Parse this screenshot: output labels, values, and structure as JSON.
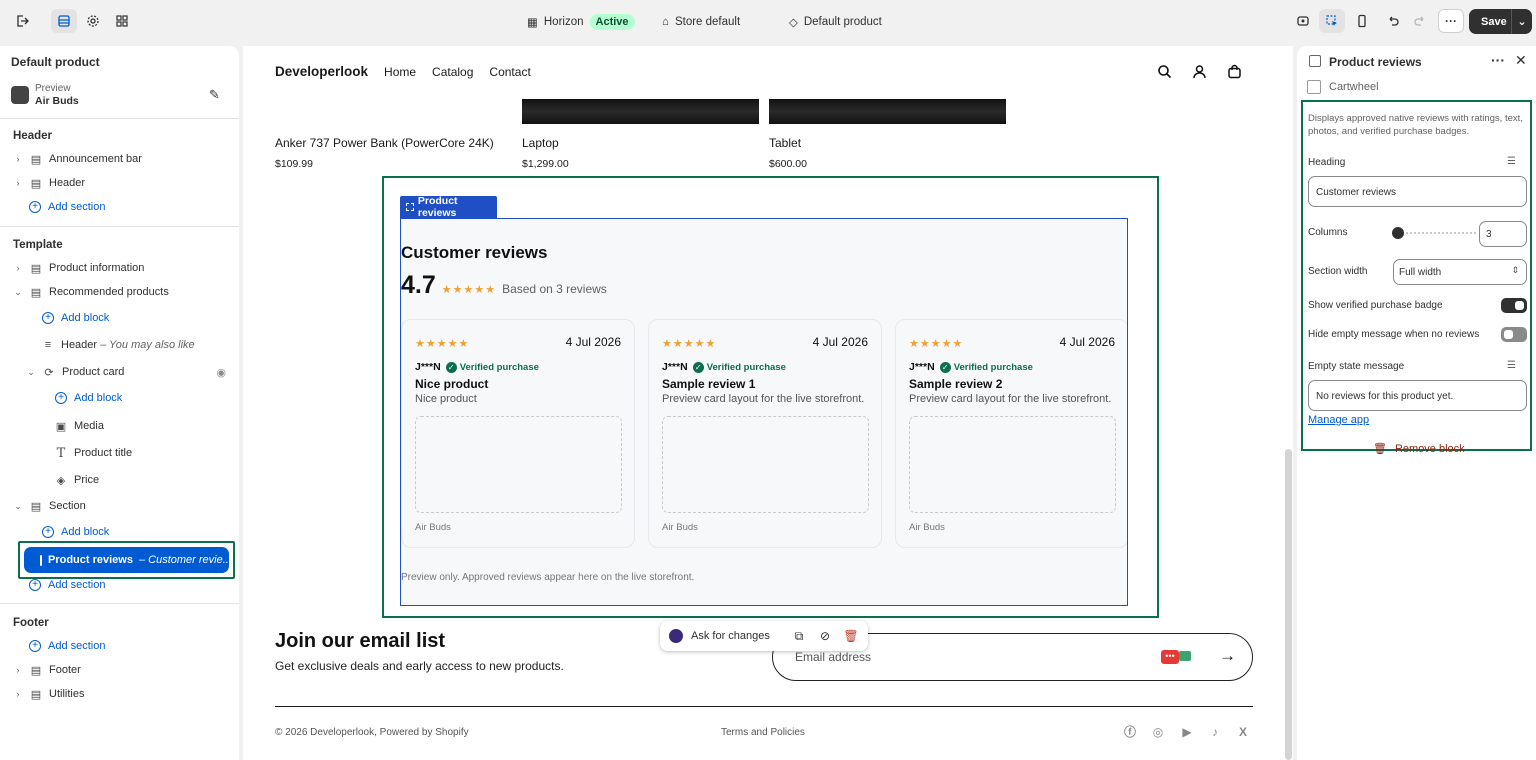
{
  "topbar": {
    "theme_name": "Horizon",
    "theme_status": "Active",
    "store": "Store default",
    "template": "Default product",
    "save": "Save"
  },
  "left_panel": {
    "title": "Default product",
    "preview_label": "Preview",
    "preview_product": "Air Buds",
    "header_group": "Header",
    "header_items": [
      "Announcement bar",
      "Header"
    ],
    "add_section": "Add section",
    "template_group": "Template",
    "product_information": "Product information",
    "recommended_products": "Recommended products",
    "add_block": "Add block",
    "header_block": "Header",
    "header_block_sub": "– You may also like",
    "product_card": "Product card",
    "media": "Media",
    "product_title": "Product title",
    "price": "Price",
    "section": "Section",
    "selected_item": "Product reviews",
    "selected_item_sub": "– Customer revie...",
    "footer_group": "Footer",
    "footer": "Footer",
    "utilities": "Utilities"
  },
  "storefront": {
    "logo": "Developerlook",
    "nav": [
      "Home",
      "Catalog",
      "Contact"
    ],
    "products": [
      {
        "name": "Anker 737 Power Bank (PowerCore 24K)",
        "price": "$109.99"
      },
      {
        "name": "Laptop",
        "price": "$1,299.00"
      },
      {
        "name": "Tablet",
        "price": "$600.00"
      }
    ],
    "block_tab": "Product reviews",
    "reviews_title": "Customer reviews",
    "rating": "4.7",
    "stars": "★★★★★",
    "based_on": "Based on 3 reviews",
    "reviews": [
      {
        "date": "4 Jul 2026",
        "author": "J***N",
        "verified": "Verified purchase",
        "title": "Nice product",
        "body": "Nice product",
        "product": "Air Buds"
      },
      {
        "date": "4 Jul 2026",
        "author": "J***N",
        "verified": "Verified purchase",
        "title": "Sample review 1",
        "body": "Preview card layout for the live storefront.",
        "product": "Air Buds"
      },
      {
        "date": "4 Jul 2026",
        "author": "J***N",
        "verified": "Verified purchase",
        "title": "Sample review 2",
        "body": "Preview card layout for the live storefront.",
        "product": "Air Buds"
      }
    ],
    "preview_note": "Preview only. Approved reviews appear here on the live storefront.",
    "ask_changes": "Ask for changes",
    "email_title": "Join our email list",
    "email_sub": "Get exclusive deals and early access to new products.",
    "email_placeholder": "Email address",
    "copyright": "© 2026 Developerlook, Powered by Shopify",
    "terms": "Terms and Policies"
  },
  "right_panel": {
    "title": "Product reviews",
    "app_name": "Cartwheel",
    "description": "Displays approved native reviews with ratings, text, photos, and verified purchase badges.",
    "heading_label": "Heading",
    "heading_value": "Customer reviews",
    "columns_label": "Columns",
    "columns_value": "3",
    "columns_fraction": 0.0,
    "section_width_label": "Section width",
    "section_width_value": "Full width",
    "verified_badge_label": "Show verified purchase badge",
    "verified_badge_on": true,
    "hide_empty_label": "Hide empty message when no reviews",
    "hide_empty_on": false,
    "empty_state_label": "Empty state message",
    "empty_state_value": "No reviews for this product yet.",
    "manage_app": "Manage app",
    "remove_block": "Remove block"
  },
  "colors": {
    "accent_blue": "#005bd3",
    "selection_green": "#0b6e4f",
    "block_blue": "#1f4fc4",
    "star": "#f0a030",
    "remove_red": "#8e1f0b"
  }
}
